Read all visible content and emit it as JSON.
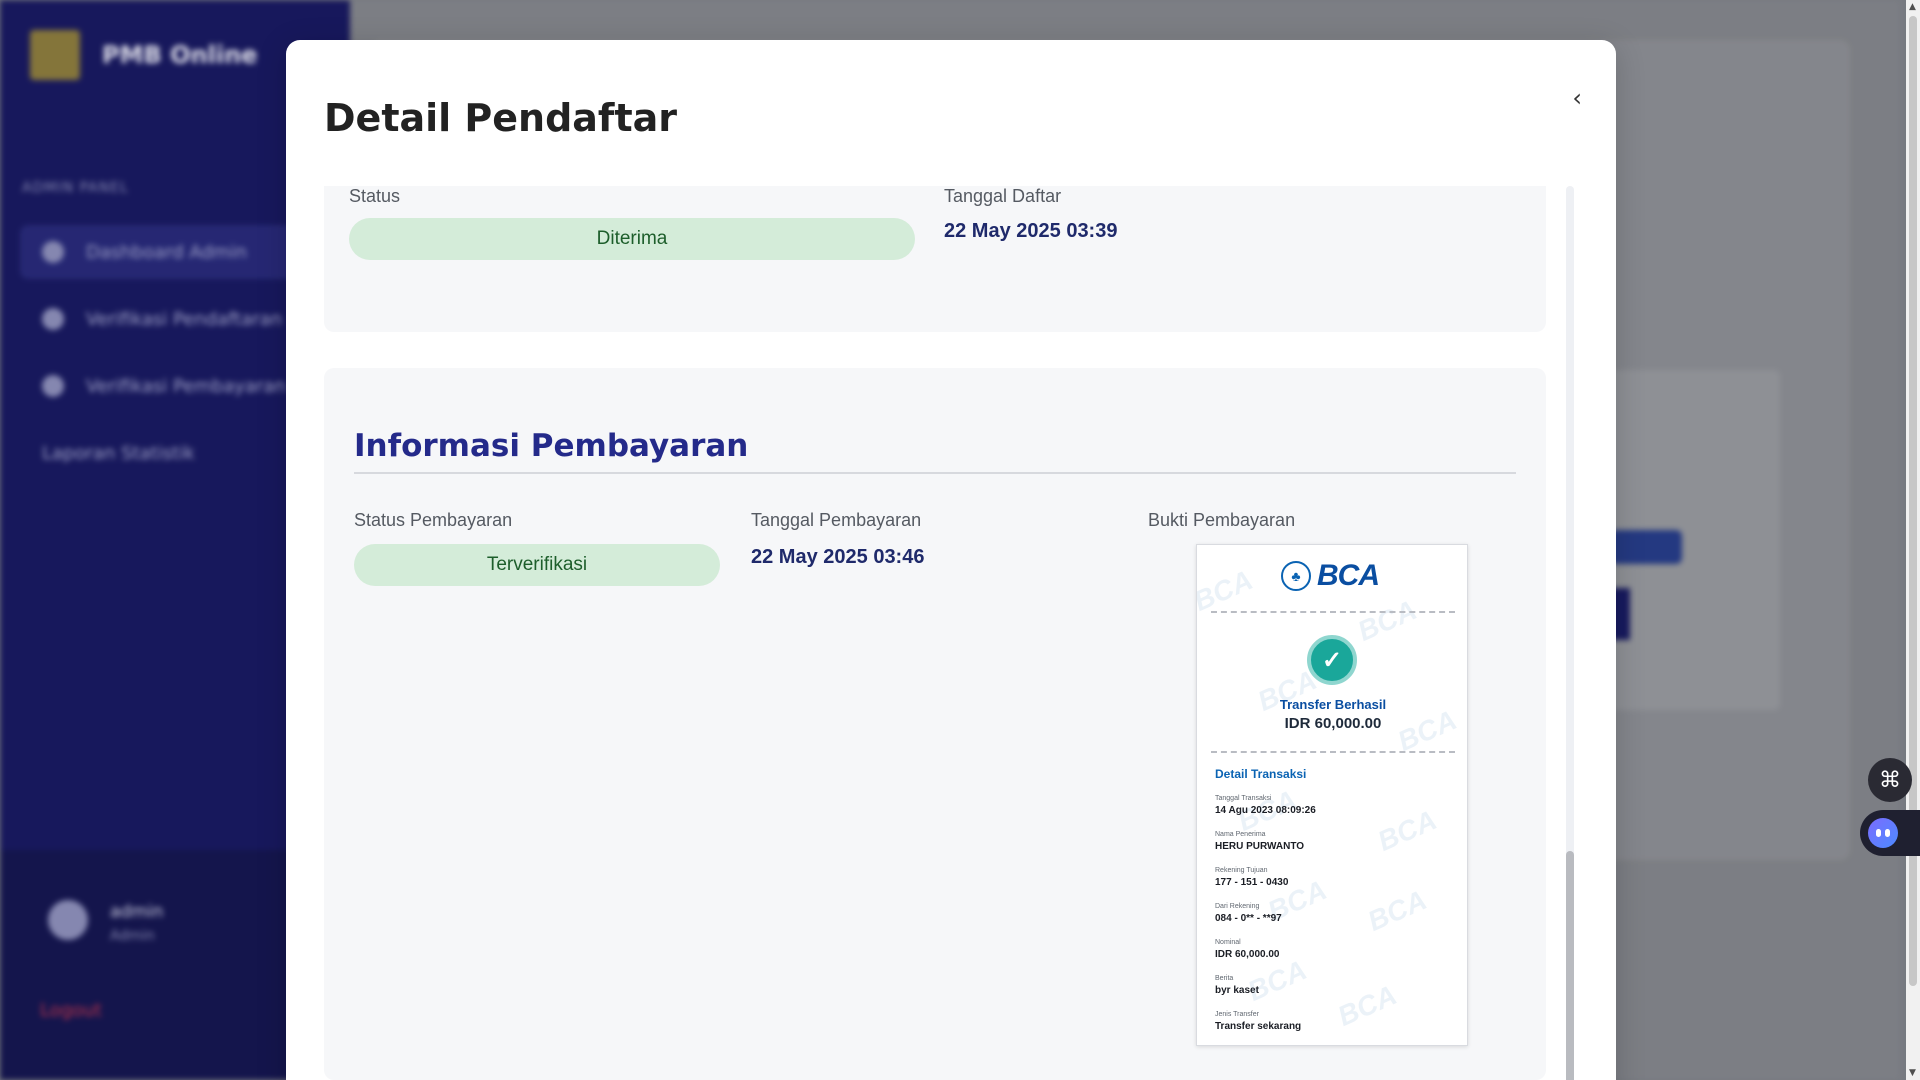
{
  "background": {
    "brand_name": "PMB Online",
    "menu_heading": "ADMIN PANEL",
    "menu_items": [
      {
        "label": "Dashboard Admin"
      },
      {
        "label": "Verifikasi Pendaftaran"
      },
      {
        "label": "Verifikasi Pembayaran"
      },
      {
        "label": "Laporan Statistik"
      }
    ],
    "user_name": "admin",
    "user_role": "Admin",
    "logout_label": "Logout"
  },
  "modal": {
    "title": "Detail Pendaftar",
    "close_icon": "chevron-left-icon",
    "registration": {
      "status_label": "Status",
      "status_value": "Diterima",
      "date_label": "Tanggal Daftar",
      "date_value": "22 May 2025 03:39"
    },
    "payment": {
      "section_title": "Informasi Pembayaran",
      "status_label": "Status Pembayaran",
      "status_value": "Terverifikasi",
      "date_label": "Tanggal Pembayaran",
      "date_value": "22 May 2025 03:46",
      "proof_label": "Bukti Pembayaran"
    }
  },
  "receipt": {
    "bank": "BCA",
    "watermark": "BCA",
    "result": "Transfer Berhasil",
    "amount": "IDR 60,000.00",
    "detail_title": "Detail Transaksi",
    "fields": [
      {
        "k": "Tanggal Transaksi",
        "v": "14 Agu 2023 08:09:26"
      },
      {
        "k": "Nama Penerima",
        "v": "HERU PURWANTO"
      },
      {
        "k": "Rekening Tujuan",
        "v": "177 - 151 - 0430"
      },
      {
        "k": "Dari Rekening",
        "v": "084 - 0** - **97"
      },
      {
        "k": "Nominal",
        "v": "IDR 60,000.00"
      },
      {
        "k": "Berita",
        "v": "byr kaset"
      },
      {
        "k": "Jenis Transfer",
        "v": "Transfer sekarang"
      }
    ]
  },
  "colors": {
    "sidebar": "#17185f",
    "accent": "#242a8a",
    "badge_bg": "#d4ecd9",
    "badge_text": "#1d5e2b"
  }
}
